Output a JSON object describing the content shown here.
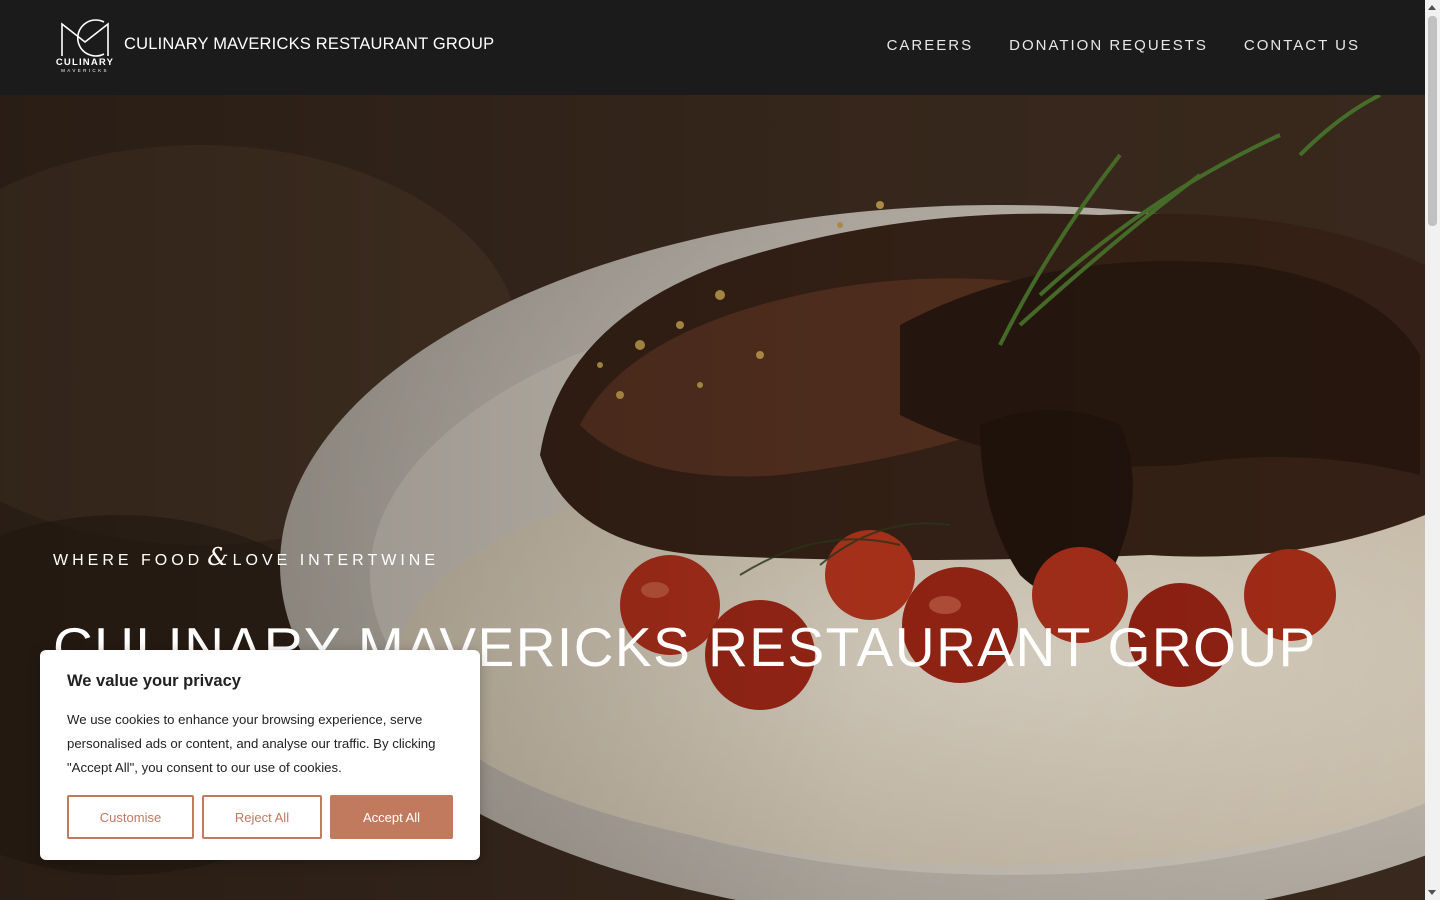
{
  "header": {
    "logo_word": "CULINARY",
    "logo_sub": "MAVERICKS",
    "brand_name": "CULINARY MAVERICKS RESTAURANT GROUP",
    "nav": [
      "CAREERS",
      "DONATION REQUESTS",
      "CONTACT US"
    ]
  },
  "hero": {
    "tagline_left": "WHERE FOOD",
    "tagline_amp": "&",
    "tagline_right": "LOVE INTERTWINE",
    "title": "CULINARY MAVERICKS RESTAURANT GROUP"
  },
  "cookie": {
    "title": "We value your privacy",
    "text": "We use cookies to enhance your browsing experience, serve personalised ads or content, and analyse our traffic. By clicking \"Accept All\", you consent to our use of cookies.",
    "customise_label": "Customise",
    "reject_label": "Reject All",
    "accept_label": "Accept All"
  },
  "colors": {
    "header_bg": "#1b1b1b",
    "accent": "#c27a5e"
  }
}
